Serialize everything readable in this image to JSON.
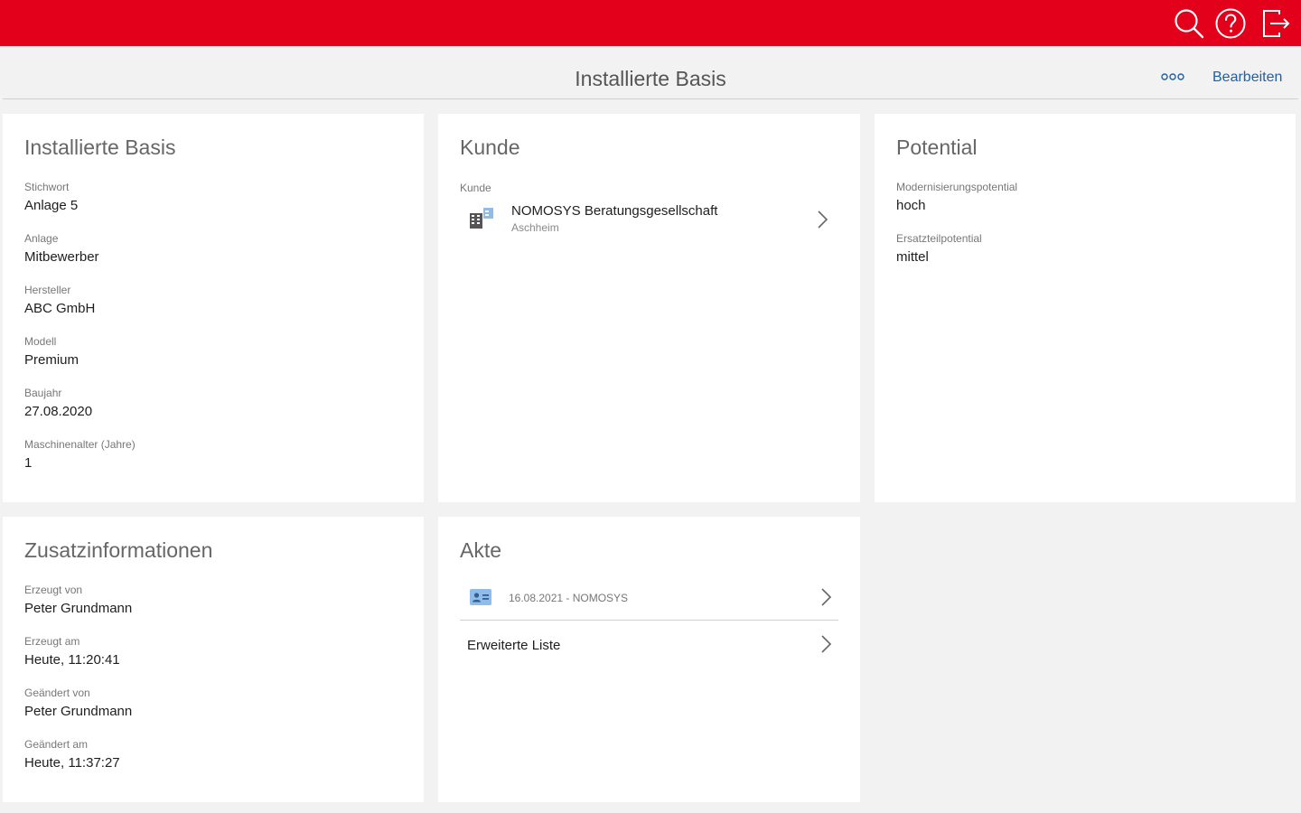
{
  "topbar": {
    "color": "#e2001a",
    "icons": [
      "search-icon",
      "help-icon",
      "logout-icon"
    ]
  },
  "header": {
    "title": "Installierte Basis",
    "more_icon": "more-icon",
    "edit_label": "Bearbeiten"
  },
  "basis": {
    "title": "Installierte Basis",
    "fields": [
      {
        "label": "Stichwort",
        "value": "Anlage 5"
      },
      {
        "label": "Anlage",
        "value": "Mitbewerber"
      },
      {
        "label": "Hersteller",
        "value": "ABC GmbH"
      },
      {
        "label": "Modell",
        "value": "Premium"
      },
      {
        "label": "Baujahr",
        "value": "27.08.2020"
      },
      {
        "label": "Maschinenalter (Jahre)",
        "value": "1"
      }
    ]
  },
  "kunde": {
    "title": "Kunde",
    "label": "Kunde",
    "name": "NOMOSYS Beratungsgesellschaft",
    "city": "Aschheim",
    "icon": "building-icon"
  },
  "potential": {
    "title": "Potential",
    "fields": [
      {
        "label": "Modernisierungspotential",
        "value": "hoch"
      },
      {
        "label": "Ersatzteilpotential",
        "value": "mittel"
      }
    ]
  },
  "zusatz": {
    "title": "Zusatzinformationen",
    "fields": [
      {
        "label": "Erzeugt von",
        "value": "Peter Grundmann"
      },
      {
        "label": "Erzeugt am",
        "value": "Heute, 11:20:41"
      },
      {
        "label": "Geändert von",
        "value": "Peter Grundmann"
      },
      {
        "label": "Geändert am",
        "value": "Heute, 11:37:27"
      }
    ]
  },
  "akte": {
    "title": "Akte",
    "entry": "16.08.2021 - NOMOSYS",
    "entry_icon": "contact-card-icon",
    "list_label": "Erweiterte Liste"
  }
}
